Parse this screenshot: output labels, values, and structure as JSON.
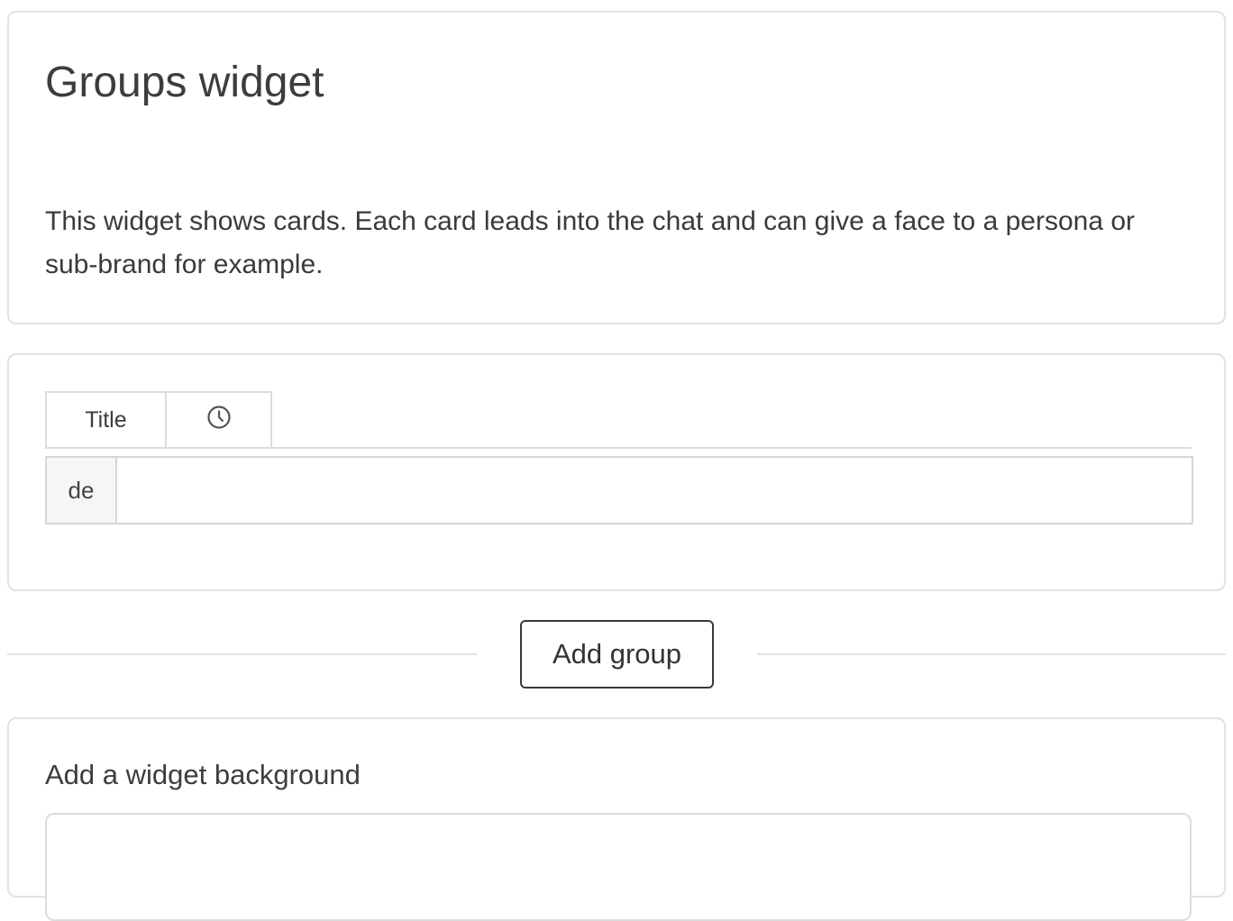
{
  "intro": {
    "title": "Groups widget",
    "description": "This widget shows cards. Each card leads into the chat and can give a face to a persona or sub-brand for example."
  },
  "groups_editor": {
    "tabs": [
      {
        "label": "Title",
        "icon": ""
      },
      {
        "label": "",
        "icon": "clock-icon"
      }
    ],
    "language": "de",
    "title_value": ""
  },
  "actions": {
    "add_group_label": "Add group"
  },
  "background": {
    "label": "Add a widget background"
  }
}
